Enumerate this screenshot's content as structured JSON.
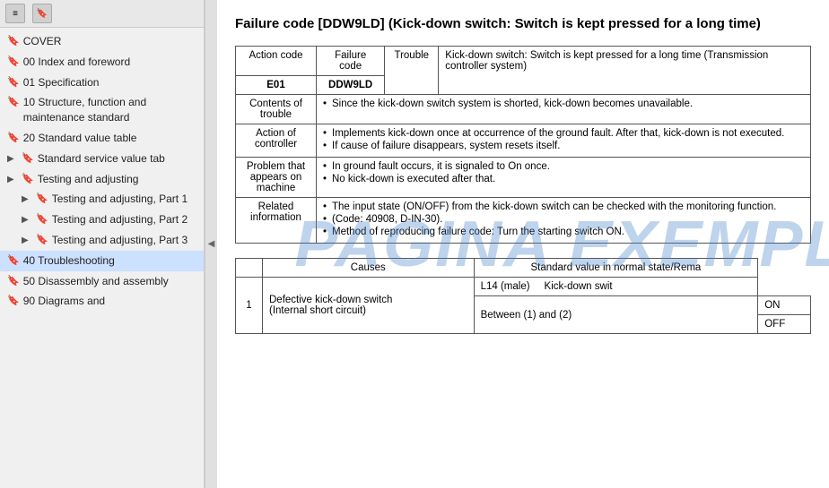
{
  "sidebar": {
    "toolbar": {
      "icon1": "≡",
      "icon2": "🔖"
    },
    "items": [
      {
        "id": "cover",
        "label": "COVER",
        "expander": "",
        "level": 0
      },
      {
        "id": "00-index",
        "label": "00 Index and foreword",
        "expander": "",
        "level": 0
      },
      {
        "id": "01-spec",
        "label": "01 Specification",
        "expander": "",
        "level": 0
      },
      {
        "id": "10-structure",
        "label": "10 Structure, function and maintenance standard",
        "expander": "",
        "level": 0
      },
      {
        "id": "20-standard",
        "label": "20 Standard value table",
        "expander": "",
        "level": 0
      },
      {
        "id": "standard-service",
        "label": "Standard service value tab",
        "expander": "▶",
        "level": 0
      },
      {
        "id": "testing-adjusting",
        "label": "Testing and adjusting",
        "expander": "▶",
        "level": 0
      },
      {
        "id": "testing-p1",
        "label": "Testing and adjusting, Part 1",
        "expander": "▶",
        "level": 1
      },
      {
        "id": "testing-p2",
        "label": "Testing and adjusting, Part 2",
        "expander": "▶",
        "level": 1
      },
      {
        "id": "testing-p3",
        "label": "Testing and adjusting, Part 3",
        "expander": "▶",
        "level": 1
      },
      {
        "id": "40-trouble",
        "label": "40 Troubleshooting",
        "expander": "",
        "level": 0,
        "active": true
      },
      {
        "id": "50-disassembly",
        "label": "50 Disassembly and assembly",
        "expander": "",
        "level": 0
      },
      {
        "id": "90-diagrams",
        "label": "90 Diagrams and",
        "expander": "",
        "level": 0
      }
    ]
  },
  "main": {
    "title": "Failure code [DDW9LD] (Kick-down switch: Switch is kept pressed for a long time)",
    "table1": {
      "headers": [
        "Action code",
        "Failure code",
        "Trouble"
      ],
      "code_row": [
        "E01",
        "DDW9LD"
      ],
      "trouble_desc": "Kick-down switch: Switch is kept pressed for a long time (Transmission controller system)",
      "rows": [
        {
          "label": "Contents of trouble",
          "content": "• Since the kick-down switch system is shorted, kick-down becomes unavailable."
        },
        {
          "label": "Action of controller",
          "content": "• Implements kick-down once at occurrence of the ground fault. After that, kick-down is not executed.\n• If cause of failure disappears, system resets itself."
        },
        {
          "label": "Problem that appears on machine",
          "content": "• In ground fault occurs, it is signaled to On once.\n  No kick-down is executed after that."
        },
        {
          "label": "Related information",
          "content": "• The input state (ON/OFF) from the kick-down switch can be checked with the monitoring function.\n  (Code: 40908, D-IN-30).\n• Method of reproducing failure code: Turn the starting switch ON."
        }
      ]
    },
    "table2": {
      "headers": [
        "",
        "Causes",
        "Standard value in normal state/Rema"
      ],
      "rows": [
        {
          "num": "1",
          "cause": "Defective kick-down switch (Internal short circuit)",
          "sub_rows": [
            {
              "check_point": "L14 (male)",
              "measure": "Kick-down swit"
            },
            {
              "check_point": "Between (1) and (2)",
              "values": [
                "ON",
                "OFF"
              ]
            }
          ]
        }
      ]
    }
  },
  "watermark": "PAGINA EXEMPLU"
}
